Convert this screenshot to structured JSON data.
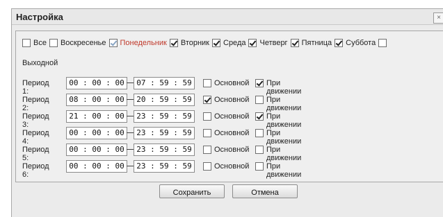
{
  "dialog": {
    "title": "Настройка",
    "close_glyph": "×"
  },
  "days": [
    {
      "label": "Все",
      "checked": false,
      "red": false,
      "dim": false
    },
    {
      "label": "Воскресенье",
      "checked": false,
      "red": false,
      "dim": false
    },
    {
      "label": "Понедельник",
      "checked": true,
      "red": true,
      "dim": true
    },
    {
      "label": "Вторник",
      "checked": true,
      "red": false,
      "dim": false
    },
    {
      "label": "Среда",
      "checked": true,
      "red": false,
      "dim": false
    },
    {
      "label": "Четверг",
      "checked": true,
      "red": false,
      "dim": false
    },
    {
      "label": "Пятница",
      "checked": true,
      "red": false,
      "dim": false
    },
    {
      "label": "Суббота",
      "checked": true,
      "red": false,
      "dim": false
    }
  ],
  "holiday": {
    "label": "Выходной",
    "checked": false
  },
  "labels": {
    "main": "Основной",
    "motion": "При движении"
  },
  "periods": [
    {
      "label": "Период 1:",
      "start": "00 : 00 : 00",
      "end": "07 : 59 : 59",
      "main": false,
      "motion": true
    },
    {
      "label": "Период 2:",
      "start": "08 : 00 : 00",
      "end": "20 : 59 : 59",
      "main": true,
      "motion": false
    },
    {
      "label": "Период 3:",
      "start": "21 : 00 : 00",
      "end": "23 : 59 : 59",
      "main": false,
      "motion": true
    },
    {
      "label": "Период 4:",
      "start": "00 : 00 : 00",
      "end": "23 : 59 : 59",
      "main": false,
      "motion": false
    },
    {
      "label": "Период 5:",
      "start": "00 : 00 : 00",
      "end": "23 : 59 : 59",
      "main": false,
      "motion": false
    },
    {
      "label": "Период 6:",
      "start": "00 : 00 : 00",
      "end": "23 : 59 : 59",
      "main": false,
      "motion": false
    }
  ],
  "buttons": {
    "save": "Сохранить",
    "cancel": "Отмена"
  }
}
